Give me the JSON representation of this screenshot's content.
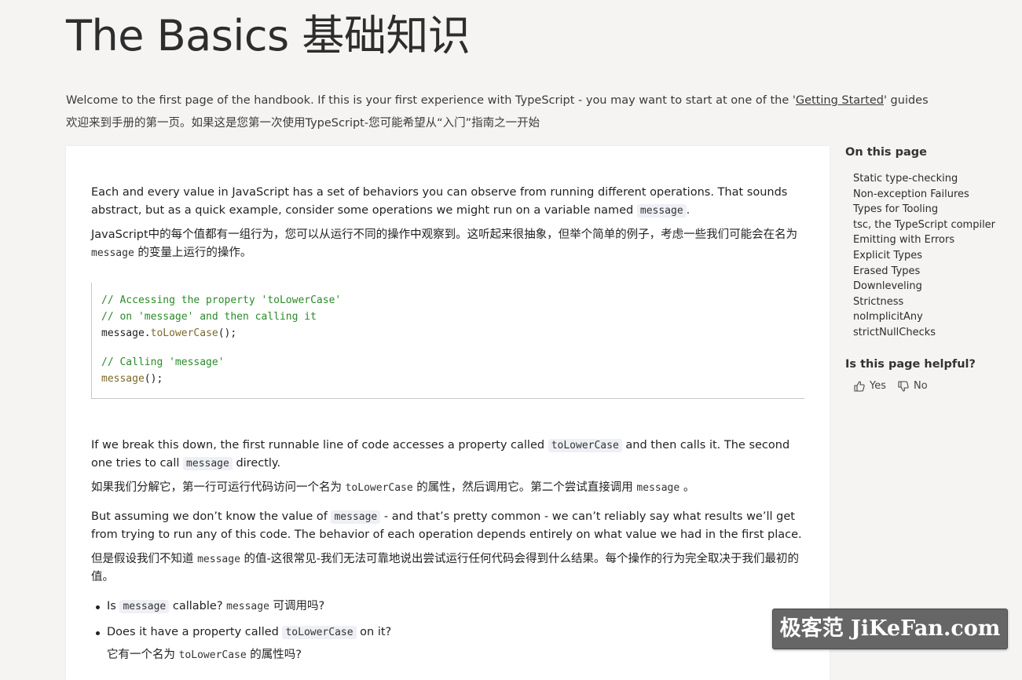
{
  "page": {
    "title": "The Basics 基础知识",
    "intro_before_link": "Welcome to the first page of the handbook. If this is your first experience with TypeScript - you may want to start at one of the '",
    "intro_link": "Getting Started",
    "intro_after_link": "' guides",
    "intro_zh": "欢迎来到手册的第一页。如果这是您第一次使用TypeScript-您可能希望从“入门”指南之一开始"
  },
  "article": {
    "p1_a": "Each and every value in JavaScript has a set of behaviors you can observe from running different operations. That sounds abstract, but as a quick example, consider some operations we might run on a variable named ",
    "p1_code": "message",
    "p1_b": ".",
    "p1_zh_a": "JavaScript中的每个值都有一组行为，您可以从运行不同的操作中观察到。这听起来很抽象，但举个简单的例子，考虑一些我们可能会在名为 ",
    "p1_zh_code": "message",
    "p1_zh_b": " 的变量上运行的操作。",
    "code_lines": [
      "// Accessing the property 'toLowerCase'",
      "// on 'message' and then calling it",
      "message.",
      "toLowerCase",
      "();",
      "// Calling 'message'",
      "message",
      "();"
    ],
    "p2_a": "If we break this down, the first runnable line of code accesses a property called ",
    "p2_code1": "toLowerCase",
    "p2_b": " and then calls it. The second one tries to call ",
    "p2_code2": "message",
    "p2_c": " directly.",
    "p2_zh_a": "如果我们分解它，第一行可运行代码访问一个名为 ",
    "p2_zh_code1": "toLowerCase",
    "p2_zh_b": " 的属性，然后调用它。第二个尝试直接调用 ",
    "p2_zh_code2": "message",
    "p2_zh_c": " 。",
    "p3_a": "But assuming we don’t know the value of ",
    "p3_code": "message",
    "p3_b": " - and that’s pretty common - we can’t reliably say what results we’ll get from trying to run any of this code. The behavior of each operation depends entirely on what value we had in the first place.",
    "p3_zh_a": "但是假设我们不知道 ",
    "p3_zh_code": "message",
    "p3_zh_b": " 的值-这很常见-我们无法可靠地说出尝试运行任何代码会得到什么结果。每个操作的行为完全取决于我们最初的值。",
    "b1_a": "Is ",
    "b1_code": "message",
    "b1_b": " callable? ",
    "b1_zh_code": "message",
    "b1_zh": " 可调用吗?",
    "b2_a": "Does it have a property called ",
    "b2_code": "toLowerCase",
    "b2_b": " on it?",
    "b2_zh_a": "它有一个名为 ",
    "b2_zh_code": "toLowerCase",
    "b2_zh_b": " 的属性吗?"
  },
  "toc": {
    "heading": "On this page",
    "items": [
      "Static type-checking",
      "Non-exception Failures",
      "Types for Tooling",
      "tsc, the TypeScript compiler",
      "Emitting with Errors",
      "Explicit Types",
      "Erased Types",
      "Downleveling",
      "Strictness",
      "noImplicitAny",
      "strictNullChecks"
    ],
    "helpful_heading": "Is this page helpful?",
    "yes_label": "Yes",
    "no_label": "No"
  },
  "watermark": "极客范 JiKeFan.com",
  "colors": {
    "background": "#f6f4f3",
    "card": "#ffffff",
    "code_comment": "#2a8a2a",
    "code_method": "#7a6a2a"
  }
}
